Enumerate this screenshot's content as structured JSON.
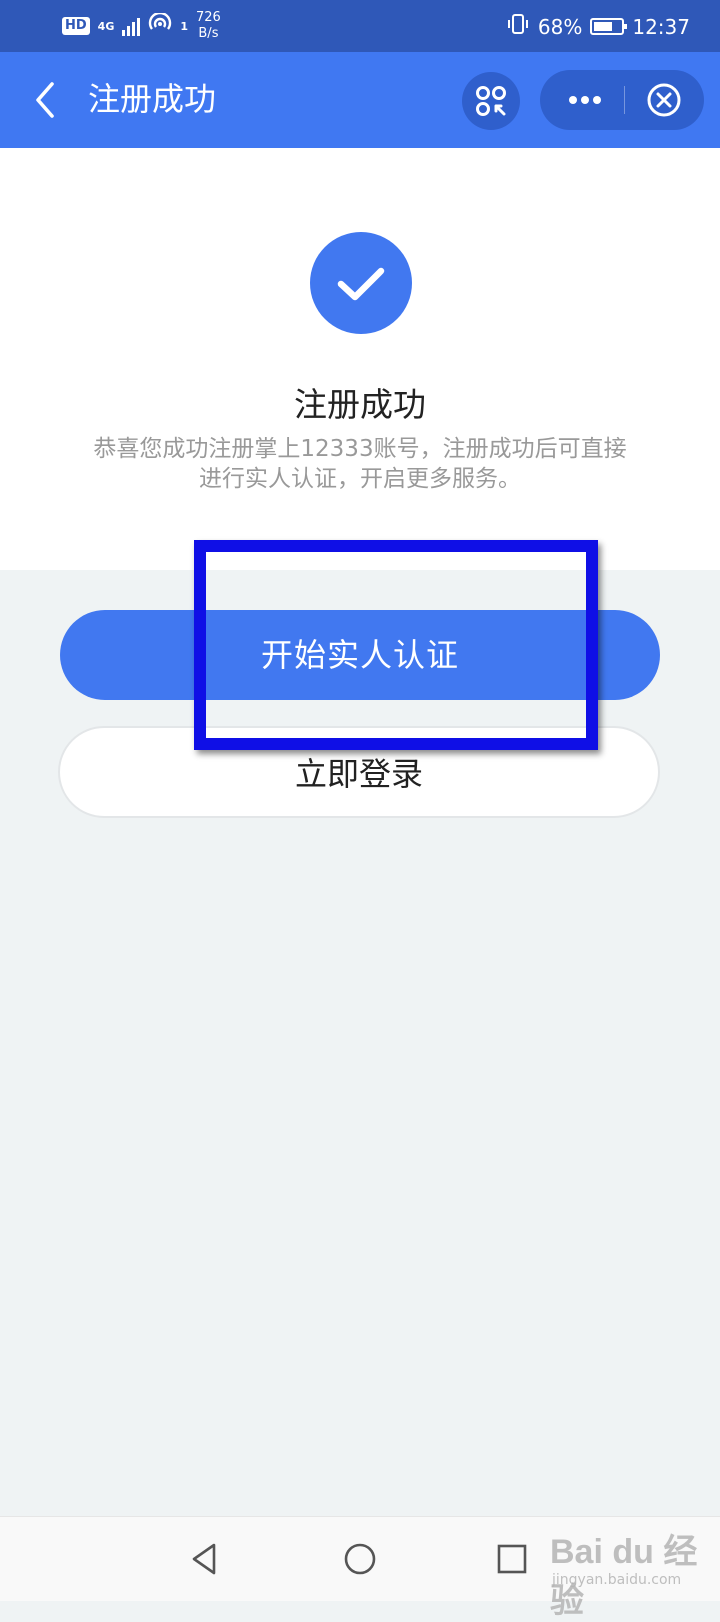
{
  "status_bar": {
    "hd_label": "HD",
    "network_label": "4G",
    "signal_slot": "1",
    "speed_value": "726",
    "speed_unit": "B/s",
    "battery_percent": "68%",
    "battery_level": 0.68,
    "time": "12:37"
  },
  "nav": {
    "title": "注册成功",
    "back_icon": "chevron-left-icon",
    "mini_app_icon": "mini-program-icon",
    "more_icon": "more-dots-icon",
    "close_icon": "close-circle-icon"
  },
  "success": {
    "icon": "check-icon",
    "title": "注册成功",
    "description_line1": "恭喜您成功注册掌上12333账号，注册成功后可直接",
    "description_line2": "进行实人认证，开启更多服务。"
  },
  "actions": {
    "verify_label": "开始实人认证",
    "login_label": "立即登录"
  },
  "system_nav": {
    "back_icon": "triangle-back-icon",
    "home_icon": "circle-home-icon",
    "recent_icon": "square-recent-icon"
  },
  "watermark": {
    "logo_text": "Bai du 经验",
    "url": "jingyan.baidu.com"
  },
  "colors": {
    "status_bar": "#2f58b8",
    "header": "#4078f2",
    "primary": "#4178f0",
    "highlight": "#0f0fe6",
    "page_bg": "#eff3f4"
  }
}
